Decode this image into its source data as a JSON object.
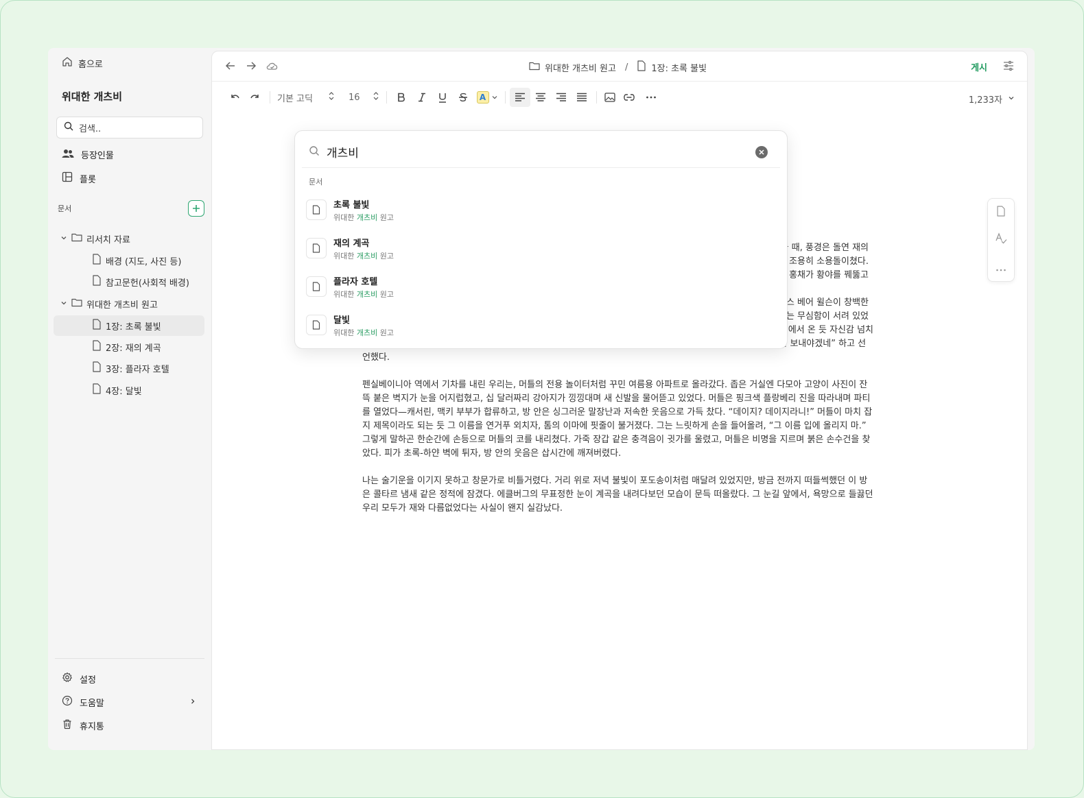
{
  "app": {
    "home_label": "홈으로",
    "project_title": "위대한 개츠비"
  },
  "sidebar": {
    "search_placeholder": "검색..",
    "nav": [
      {
        "label": "등장인물",
        "icon": "people-icon"
      },
      {
        "label": "플롯",
        "icon": "layout-icon"
      }
    ],
    "docs_label": "문서",
    "tree": [
      {
        "label": "리서치 자료",
        "type": "folder",
        "expanded": true
      },
      {
        "label": "배경 (지도, 사진 등)",
        "type": "file"
      },
      {
        "label": "참고문헌(사회적 배경)",
        "type": "file"
      },
      {
        "label": "위대한 개츠비 원고",
        "type": "folder",
        "expanded": true
      },
      {
        "label": "1장: 초록 불빛",
        "type": "file",
        "active": true
      },
      {
        "label": "2장: 재의 계곡",
        "type": "file"
      },
      {
        "label": "3장: 플라자 호텔",
        "type": "file"
      },
      {
        "label": "4장: 달빛",
        "type": "file"
      }
    ],
    "footer": [
      {
        "label": "설정",
        "icon": "gear-icon"
      },
      {
        "label": "도움말",
        "icon": "help-icon"
      },
      {
        "label": "휴지통",
        "icon": "trash-icon"
      }
    ]
  },
  "topbar": {
    "breadcrumb_folder": "위대한 개츠비 원고",
    "breadcrumb_sep": "/",
    "breadcrumb_doc": "1장: 초록 불빛",
    "publish_label": "게시"
  },
  "toolbar": {
    "font_family": "기본 고딕",
    "font_size": "16",
    "highlight_letter": "A",
    "word_count": "1,233자"
  },
  "editor": {
    "p1_lines": [
      "을 때, 풍경은 돌연 재의",
      "조용히 소용돌이쳤다.",
      "홍채가 황야를 꿰뚫고"
    ],
    "p2_lines": [
      "니스 베어 윌슨이 창백한",
      "는 무심함이 서려 있었"
    ],
    "p2_rest": "다. 잠시 뒤, 머틀 일행이 몽골몽골 들이닥쳤다. 불탑 앞은 잠깐 사람들 틈바구니로 내딛고서는 그러곤, 이시 먼 도시에서 온 듯 자신감 넘치는 목소리로 뉴욕 이야기를 꺼냈다. 톰은 그녀를 힐끗 보더니, 내 쪽으로 고개를 돌려 “오늘은 맨해튼에서 시간을 좀 보내야겠네” 하고 선언했다.",
    "p3": "펜실베이니아 역에서 기차를 내린 우리는, 머틀의 전용 놀이터처럼 꾸민 여름용 아파트로 올라갔다. 좁은 거실엔 다모아 고양이 사진이 잔뜩 붙은 벽지가 눈을 어지럽혔고, 십 달러짜리 강아지가 낑낑대며 새 신발을 물어뜯고 있었다. 머틀은 핑크색 플랑베리 진을 따라내며 파티를 열었다—캐서린, 맥키 부부가 합류하고, 방 안은 싱그러운 말장난과 저속한 웃음으로 가득 찼다. “데이지? 데이지라니!” 머틀이 마치 잡지 제목이라도 되는 듯 그 이름을 연거푸 외치자, 톰의 이마에 핏줄이 불거졌다. 그는 느릿하게 손을 들어올려, “그 이름 입에 올리지 마.” 그렇게 말하곤 한순간에 손등으로 머틀의 코를 내리쳤다. 가죽 장갑 같은 충격음이 귓가를 울렸고, 머틀은 비명을 지르며 붉은 손수건을 찾았다. 피가 초록-하얀 벽에 튀자, 방 안의 웃음은 삽시간에 깨져버렸다.",
    "p4": "나는 술기운을 이기지 못하고 창문가로 비틀거렸다. 거리 위로 저녁 불빛이 포도송이처럼 매달려 있었지만, 방금 전까지 떠들썩했던 이 방은 콜타르 냄새 같은 정적에 잠겼다. 에클버그의 무표정한 눈이 계곡을 내려다보던 모습이 문득 떠올랐다. 그 눈길 앞에서, 욕망으로 들끓던 우리 모두가 재와 다름없었다는 사실이 왠지 실감났다."
  },
  "search_popup": {
    "query": "개츠비",
    "section_label": "문서",
    "results": [
      {
        "title": "초록 불빛",
        "sub_prefix": "위대한 ",
        "sub_match": "개츠비",
        "sub_suffix": " 원고"
      },
      {
        "title": "재의 계곡",
        "sub_prefix": "위대한 ",
        "sub_match": "개츠비",
        "sub_suffix": " 원고"
      },
      {
        "title": "플라자 호텔",
        "sub_prefix": "위대한 ",
        "sub_match": "개츠비",
        "sub_suffix": " 원고"
      },
      {
        "title": "달빛",
        "sub_prefix": "위대한 ",
        "sub_match": "개츠비",
        "sub_suffix": " 원고"
      }
    ]
  },
  "colors": {
    "accent": "#2a9d63",
    "frame_bg": "#e8f7e8",
    "sidebar_bg": "#f5f5f5"
  }
}
